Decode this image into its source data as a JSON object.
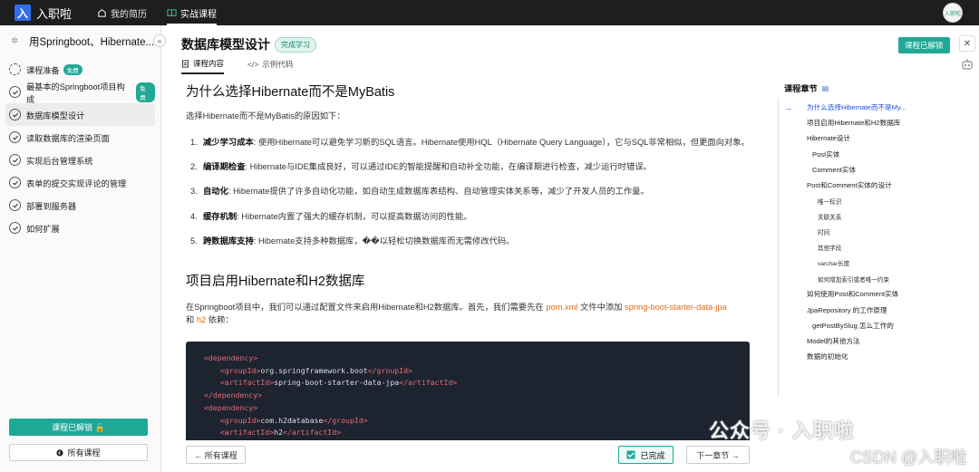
{
  "topbar": {
    "logo_mark": "入",
    "logo_text": "入职啦",
    "nav": [
      {
        "label": "我的简历"
      },
      {
        "label": "实战课程"
      }
    ],
    "avatar_text": "入职啦"
  },
  "sidebar": {
    "course_title": "用Springboot、Hibernate...",
    "collapse_icon": "«",
    "items": [
      {
        "label": "课程准备",
        "badge": "免费",
        "status": "in-progress"
      },
      {
        "label": "最基本的Springboot项目构成",
        "badge": "免费",
        "status": "done"
      },
      {
        "label": "数据库模型设计",
        "badge": "",
        "status": "done",
        "active": true
      },
      {
        "label": "读取数据库的渲染页面",
        "badge": "",
        "status": "done"
      },
      {
        "label": "实现后台管理系统",
        "badge": "",
        "status": "done"
      },
      {
        "label": "表单的提交实现评论的管理",
        "badge": "",
        "status": "done"
      },
      {
        "label": "部署到服务器",
        "badge": "",
        "status": "done"
      },
      {
        "label": "如何扩展",
        "badge": "",
        "status": "done"
      }
    ],
    "unlock_label": "课程已解锁 🔓",
    "all_courses_label": "所有课程"
  },
  "header": {
    "title": "数据库模型设计",
    "status_badge": "完成学习",
    "unlocked_badge": "课程已解锁",
    "tabs": [
      {
        "label": "课程内容"
      },
      {
        "label": "示例代码"
      }
    ]
  },
  "article": {
    "h_why": "为什么选择Hibernate而不是MyBatis",
    "intro": "选择Hibernate而不是MyBatis的原因如下：",
    "reasons": [
      {
        "num": "1.",
        "term": "减少学习成本",
        "text": ": 使用Hibernate可以避免学习新的SQL语言。Hibernate使用HQL（Hibernate Query Language），它与SQL非常相似，但更面向对象。"
      },
      {
        "num": "2.",
        "term": "编译期检查",
        "text": ": Hibernate与IDE集成良好，可以通过IDE的智能提醒和自动补全功能，在编译期进行检查，减少运行时错误。"
      },
      {
        "num": "3.",
        "term": "自动化",
        "text": ": Hibernate提供了许多自动化功能，如自动生成数据库表结构、自动管理实体关系等，减少了开发人员的工作量。"
      },
      {
        "num": "4.",
        "term": "缓存机制",
        "text": ": Hibernate内置了强大的缓存机制，可以提高数据访问的性能。"
      },
      {
        "num": "5.",
        "term": "跨数据库支持",
        "text": ": Hibernate支持多种数据库，��以轻松切换数据库而无需修改代码。"
      }
    ],
    "h_enable": "项目启用Hibernate和H2数据库",
    "enable_p1": "在Springboot项目中，我们可以通过配置文件来启用Hibernate和H2数据库。首先，我们需要先在 ",
    "enable_file": "pom.xml",
    "enable_p2": " 文件中添加 ",
    "enable_dep": "spring-boot-starter-data-jpa",
    "enable_p3": "和 ",
    "enable_h2": "h2",
    "enable_p4": " 依赖：",
    "code": {
      "dep_open": "<dependency>",
      "dep_close": "</dependency>",
      "g1_open": "<groupId>",
      "g1_val": "org.springframework.boot",
      "g1_close": "</groupId>",
      "a1_open": "<artifactId>",
      "a1_val": "spring-boot-starter-data-jpa",
      "a1_close": "</artifactId>",
      "g2_val": "com.h2database",
      "a2_val": "h2"
    }
  },
  "footer": {
    "prev": "← 所有课程",
    "done": "已完成",
    "next": "下一章节 →"
  },
  "toc": {
    "title": "课程章节",
    "items": [
      {
        "label": "为什么选择Hibernate而不是My...",
        "level": 1,
        "active": true
      },
      {
        "label": "项目启用Hibernate和H2数据库",
        "level": 1
      },
      {
        "label": "Hibernate设计",
        "level": 1
      },
      {
        "label": "Post实体",
        "level": 2
      },
      {
        "label": "Comment实体",
        "level": 2
      },
      {
        "label": "Post和Comment实体的设计",
        "level": 1
      },
      {
        "label": "唯一标识",
        "level": 3
      },
      {
        "label": "关联关系",
        "level": 3
      },
      {
        "label": "时间",
        "level": 3
      },
      {
        "label": "其他字段",
        "level": 3
      },
      {
        "label": "varchar长度",
        "level": 3
      },
      {
        "label": "如何增加索引或者唯一约束",
        "level": 3
      },
      {
        "label": "如何使用Post和Comment实体",
        "level": 1
      },
      {
        "label": "JpaRepository 的工作原理",
        "level": 1
      },
      {
        "label": "getPostBySlug 怎么工作的",
        "level": 2
      },
      {
        "label": "Model的其他方法",
        "level": 1
      },
      {
        "label": "数据的初始化",
        "level": 1
      }
    ]
  },
  "watermark": {
    "line1": "公众号 · 入职啦",
    "line2": "CSDN @入职啦"
  }
}
